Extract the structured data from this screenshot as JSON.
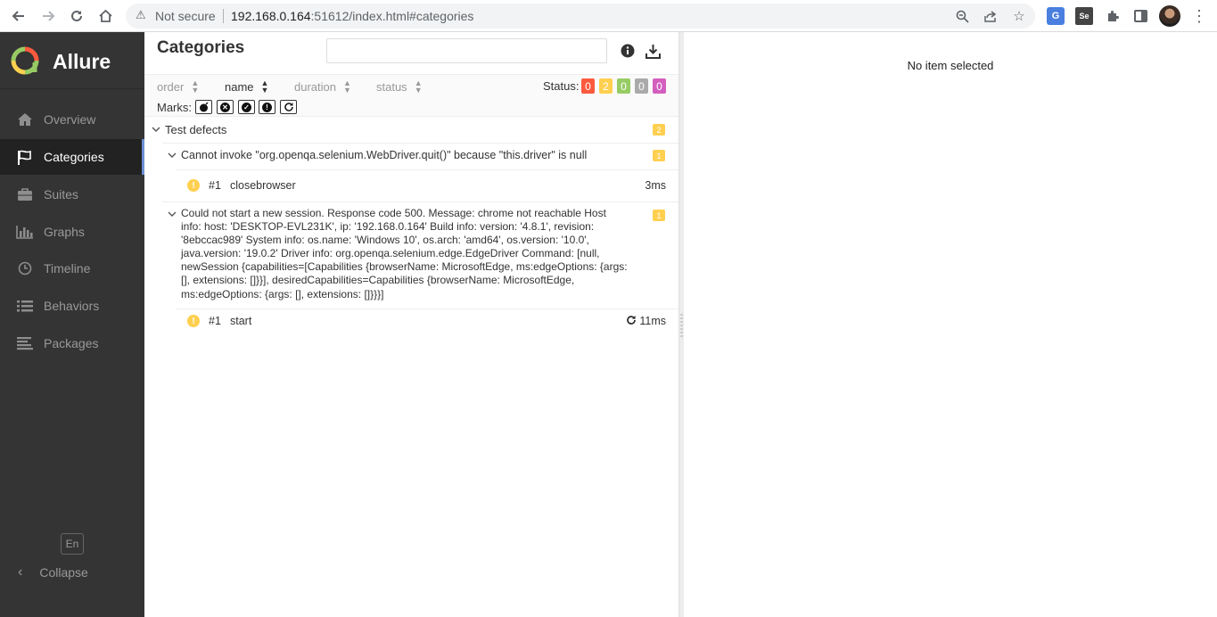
{
  "browser": {
    "security_text": "Not secure",
    "url_host": "192.168.0.164",
    "url_rest": ":51612/index.html#categories"
  },
  "sidebar": {
    "brand": "Allure",
    "items": [
      {
        "label": "Overview",
        "icon": "home-icon"
      },
      {
        "label": "Categories",
        "icon": "flag-icon"
      },
      {
        "label": "Suites",
        "icon": "briefcase-icon"
      },
      {
        "label": "Graphs",
        "icon": "bar-chart-icon"
      },
      {
        "label": "Timeline",
        "icon": "clock-icon"
      },
      {
        "label": "Behaviors",
        "icon": "list-icon"
      },
      {
        "label": "Packages",
        "icon": "align-left-icon"
      }
    ],
    "active_item": "Categories",
    "language": "En",
    "collapse_label": "Collapse"
  },
  "pane": {
    "title": "Categories",
    "search_value": "",
    "sort": {
      "order": "order",
      "name": "name",
      "duration": "duration",
      "status": "status",
      "active": "name"
    },
    "status_label": "Status:",
    "status_counts": [
      {
        "key": "failed",
        "value": "0",
        "color": "#fd5a3e"
      },
      {
        "key": "broken",
        "value": "2",
        "color": "#ffd050"
      },
      {
        "key": "passed",
        "value": "0",
        "color": "#97cc64"
      },
      {
        "key": "skipped",
        "value": "0",
        "color": "#aaaaaa"
      },
      {
        "key": "unknown",
        "value": "0",
        "color": "#d35ebe"
      }
    ],
    "marks_label": "Marks:",
    "category": {
      "name": "Test defects",
      "count": "2",
      "groups": [
        {
          "message": "Cannot invoke \"org.openqa.selenium.WebDriver.quit()\" because \"this.driver\" is null",
          "count": "1",
          "tests": [
            {
              "index": "#1",
              "name": "closebrowser",
              "duration": "3ms",
              "retries": false
            }
          ]
        },
        {
          "message_lines": [
            "Could not start a new session. Response code 500. Message: chrome not reachable Host",
            "info: host: 'DESKTOP-EVL231K', ip: '192.168.0.164' Build info: version: '4.8.1', revision:",
            "'8ebccac989' System info: os.name: 'Windows 10', os.arch: 'amd64', os.version: '10.0',",
            "java.version: '19.0.2' Driver info: org.openqa.selenium.edge.EdgeDriver Command: [null,",
            "newSession {capabilities=[Capabilities {browserName: MicrosoftEdge, ms:edgeOptions: {args:",
            "[], extensions: []}}], desiredCapabilities=Capabilities {browserName: MicrosoftEdge,",
            "ms:edgeOptions: {args: [], extensions: []}}}]"
          ],
          "count": "1",
          "tests": [
            {
              "index": "#1",
              "name": "start",
              "duration": "11ms",
              "retries": true
            }
          ]
        }
      ]
    }
  },
  "detail": {
    "empty_text": "No item selected"
  }
}
